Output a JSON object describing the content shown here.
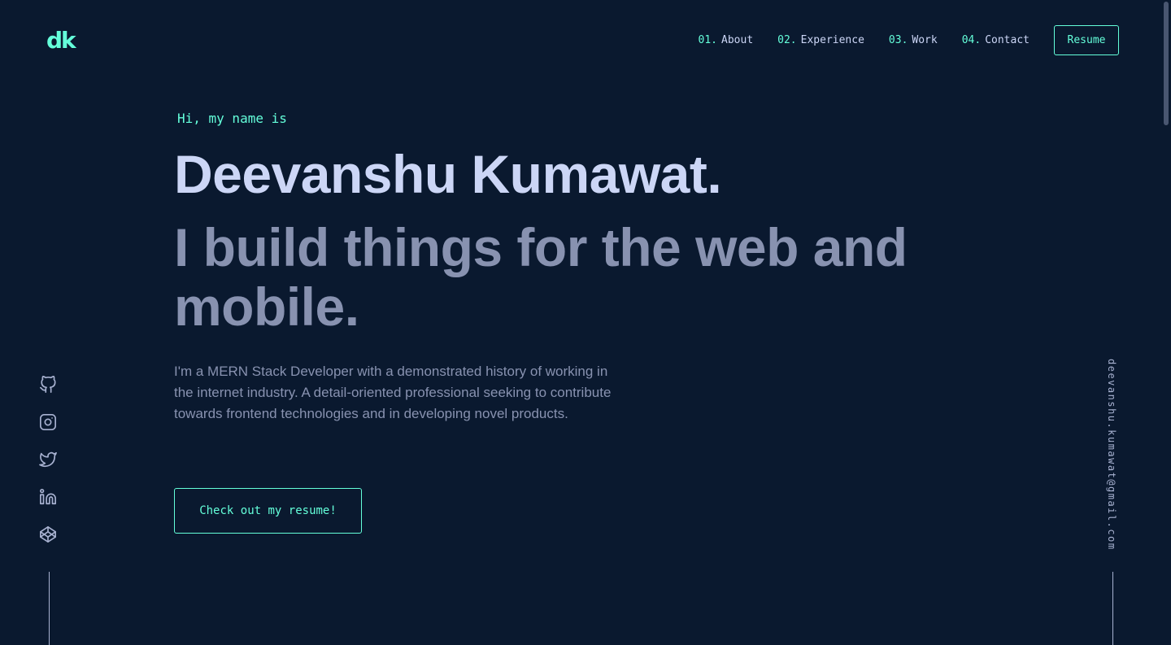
{
  "header": {
    "logo": "dk",
    "nav": [
      {
        "num": "01.",
        "label": "About"
      },
      {
        "num": "02.",
        "label": "Experience"
      },
      {
        "num": "03.",
        "label": "Work"
      },
      {
        "num": "04.",
        "label": "Contact"
      }
    ],
    "resume_label": "Resume"
  },
  "hero": {
    "greeting": "Hi, my name is",
    "name": "Deevanshu Kumawat.",
    "tagline": "I build things for the web and mobile.",
    "description": "I'm a MERN Stack Developer with a demonstrated history of working in the internet industry. A detail-oriented professional seeking to contribute towards frontend technologies and in developing novel products.",
    "cta_label": "Check out my resume!"
  },
  "social": [
    {
      "icon": "github-icon"
    },
    {
      "icon": "instagram-icon"
    },
    {
      "icon": "twitter-icon"
    },
    {
      "icon": "linkedin-icon"
    },
    {
      "icon": "codepen-icon"
    }
  ],
  "email": "deevanshu.kumawat@gmail.com",
  "colors": {
    "background": "#0a192f",
    "accent": "#64ffda",
    "heading": "#ccd6f6",
    "text": "#8892b0"
  }
}
